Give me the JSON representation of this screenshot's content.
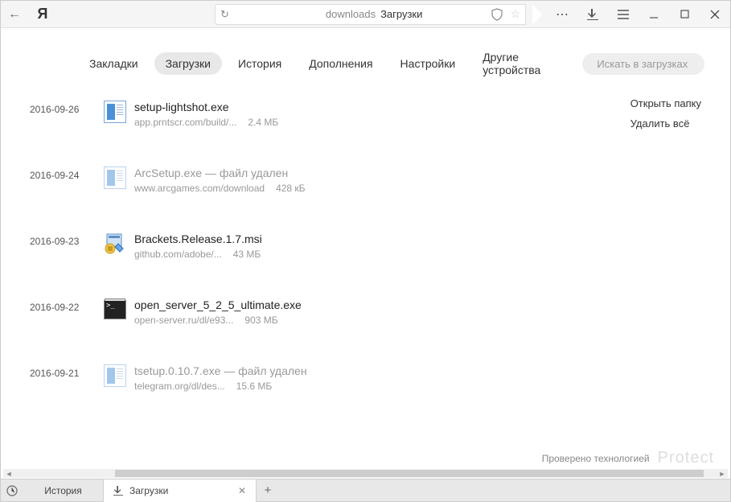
{
  "toolbar": {
    "url_prefix": "downloads",
    "url_title": "Загрузки"
  },
  "nav": {
    "items": [
      {
        "label": "Закладки"
      },
      {
        "label": "Загрузки"
      },
      {
        "label": "История"
      },
      {
        "label": "Дополнения"
      },
      {
        "label": "Настройки"
      },
      {
        "label": "Другие устройства"
      }
    ],
    "search_placeholder": "Искать в загрузках"
  },
  "actions": {
    "open_folder": "Открыть папку",
    "delete_all": "Удалить всё"
  },
  "downloads": [
    {
      "date": "2016-09-26",
      "name": "setup-lightshot.exe",
      "src": "app.prntscr.com/build/...",
      "size": "2.4 МБ",
      "icon": "doc",
      "deleted": false
    },
    {
      "date": "2016-09-24",
      "name": "ArcSetup.exe — файл удален",
      "src": "www.arcgames.com/download",
      "size": "428 кБ",
      "icon": "doc",
      "deleted": true
    },
    {
      "date": "2016-09-23",
      "name": "Brackets.Release.1.7.msi",
      "src": "github.com/adobe/...",
      "size": "43 МБ",
      "icon": "msi",
      "deleted": false
    },
    {
      "date": "2016-09-22",
      "name": "open_server_5_2_5_ultimate.exe",
      "src": "open-server.ru/dl/e93...",
      "size": "903 МБ",
      "icon": "cmd",
      "deleted": false
    },
    {
      "date": "2016-09-21",
      "name": "tsetup.0.10.7.exe — файл удален",
      "src": "telegram.org/dl/des...",
      "size": "15.6 МБ",
      "icon": "doc",
      "deleted": true
    }
  ],
  "footer": {
    "checked_by": "Проверено технологией",
    "brand": "Protect"
  },
  "tabs": {
    "history": "История",
    "downloads": "Загрузки"
  }
}
